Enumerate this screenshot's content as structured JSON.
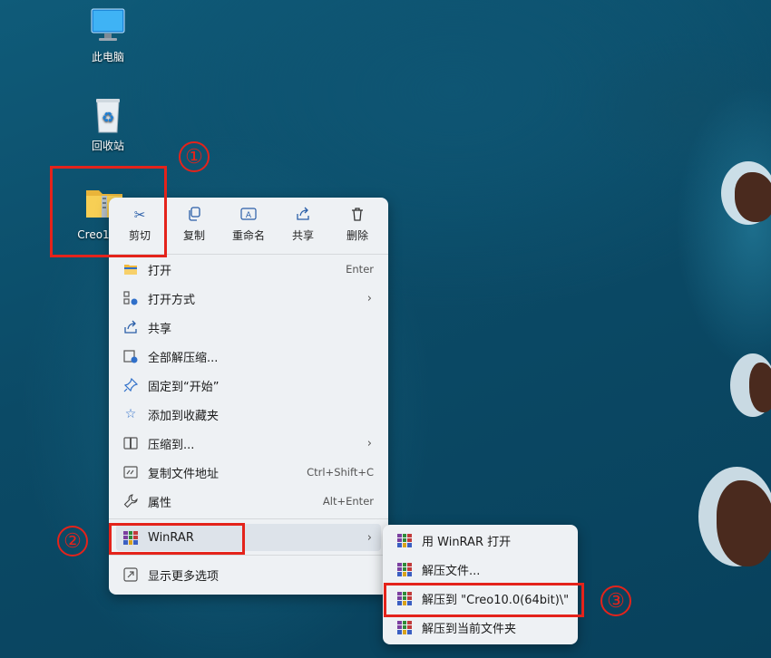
{
  "desktop": {
    "icons": [
      {
        "label": "此电脑"
      },
      {
        "label": "回收站"
      },
      {
        "label": "Creo1"
      }
    ]
  },
  "annotations": {
    "marker1": "①",
    "marker2": "②",
    "marker3": "③"
  },
  "context_menu": {
    "quick_actions": [
      {
        "label": "剪切",
        "icon": "scissors-icon"
      },
      {
        "label": "复制",
        "icon": "copy-icon"
      },
      {
        "label": "重命名",
        "icon": "rename-icon"
      },
      {
        "label": "共享",
        "icon": "share-icon"
      },
      {
        "label": "删除",
        "icon": "trash-icon"
      }
    ],
    "items": [
      {
        "label": "打开",
        "shortcut": "Enter",
        "icon": "folder-open-icon"
      },
      {
        "label": "打开方式",
        "has_submenu": true,
        "icon": "open-with-icon"
      },
      {
        "label": "共享",
        "icon": "share-icon"
      },
      {
        "label": "全部解压缩...",
        "icon": "extract-all-icon"
      },
      {
        "label": "固定到“开始”",
        "icon": "pin-icon"
      },
      {
        "label": "添加到收藏夹",
        "icon": "star-icon"
      },
      {
        "label": "压缩到...",
        "has_submenu": true,
        "icon": "compress-icon"
      },
      {
        "label": "复制文件地址",
        "shortcut": "Ctrl+Shift+C",
        "icon": "copy-path-icon"
      },
      {
        "label": "属性",
        "shortcut": "Alt+Enter",
        "icon": "wrench-icon"
      },
      {
        "label": "WinRAR",
        "has_submenu": true,
        "icon": "winrar-icon"
      },
      {
        "label": "显示更多选项",
        "icon": "more-options-icon"
      }
    ]
  },
  "winrar_submenu": {
    "items": [
      {
        "label": "用 WinRAR 打开"
      },
      {
        "label": "解压文件..."
      },
      {
        "label": "解压到 \"Creo10.0(64bit)\\\""
      },
      {
        "label": "解压到当前文件夹"
      }
    ]
  },
  "colors": {
    "annotation_red": "#e4231b",
    "menu_bg": "#eef1f4",
    "icon_blue": "#2f6fc9"
  }
}
